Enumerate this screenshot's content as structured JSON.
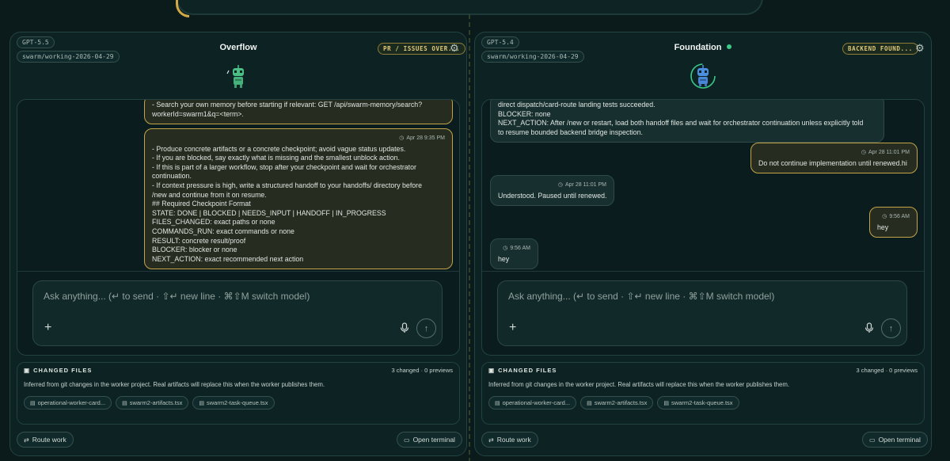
{
  "left_panel": {
    "model": "GPT-5.5",
    "branch": "swarm/working-2026-04-29",
    "title": "Overflow",
    "tag": "PR / ISSUES OVER...",
    "messages": [
      {
        "role": "user",
        "lines": [
          "- Search your own memory before starting if relevant: GET /api/swarm-memory/search?",
          "workerId=swarm1&q=<term>."
        ]
      },
      {
        "role": "user",
        "time": "Apr 28 9:35 PM",
        "lines": [
          "- Produce concrete artifacts or a concrete checkpoint; avoid vague status updates.",
          "- If you are blocked, say exactly what is missing and the smallest unblock action.",
          "- If this is part of a larger workflow, stop after your checkpoint and wait for orchestrator",
          "continuation.",
          "- If context pressure is high, write a structured handoff to your handoffs/ directory before",
          "/new and continue from it on resume.",
          "## Required Checkpoint Format",
          "STATE: DONE | BLOCKED | NEEDS_INPUT | HANDOFF | IN_PROGRESS",
          "FILES_CHANGED: exact paths or none",
          "COMMANDS_RUN: exact commands or none",
          "RESULT: concrete result/proof",
          "BLOCKER: blocker or none",
          "NEXT_ACTION: exact recommended next action"
        ]
      }
    ],
    "composer_placeholder": "Ask anything... (↵ to send · ⇧↵ new line · ⌘⇧M switch model)",
    "changed_files": {
      "heading": "CHANGED FILES",
      "count": "3 changed · 0 previews",
      "description": "Inferred from git changes in the worker project. Real artifacts will replace this when the worker publishes them.",
      "files": [
        "operational-worker-card...",
        "swarm2-artifacts.tsx",
        "swarm2-task-queue.tsx"
      ]
    },
    "route_label": "Route work",
    "terminal_label": "Open terminal"
  },
  "right_panel": {
    "model": "GPT-5.4",
    "branch": "swarm/working-2026-04-29",
    "title": "Foundation",
    "tag": "BACKEND FOUND...",
    "messages": [
      {
        "role": "agent",
        "lines": [
          "direct dispatch/card-route landing tests succeeded.",
          "BLOCKER: none",
          "NEXT_ACTION: After /new or restart, load both handoff files and wait for orchestrator continuation unless explicitly told",
          "to resume bounded backend bridge inspection."
        ]
      },
      {
        "role": "user",
        "time": "Apr 28 11:01 PM",
        "lines": [
          "Do not continue implementation until renewed.hi"
        ]
      },
      {
        "role": "agent",
        "time": "Apr 28 11:01 PM",
        "lines": [
          "Understood. Paused until renewed."
        ]
      },
      {
        "role": "user",
        "time": "9:56 AM",
        "lines": [
          "hey"
        ]
      },
      {
        "role": "agent",
        "time": "9:56 AM",
        "lines": [
          "hey"
        ]
      }
    ],
    "composer_placeholder": "Ask anything... (↵ to send · ⇧↵ new line · ⌘⇧M switch model)",
    "changed_files": {
      "heading": "CHANGED FILES",
      "count": "3 changed · 0 previews",
      "description": "Inferred from git changes in the worker project. Real artifacts will replace this when the worker publishes them.",
      "files": [
        "operational-worker-card...",
        "swarm2-artifacts.tsx",
        "swarm2-task-queue.tsx"
      ]
    },
    "route_label": "Route work",
    "terminal_label": "Open terminal"
  },
  "colors": {
    "background": "#0b1b1c",
    "user_bubble_border": "#c4a446",
    "status_online": "#3cc98a"
  },
  "icons": {
    "settings": "gear-icon",
    "send": "arrow-up-icon",
    "mic": "microphone-icon",
    "attach": "plus-icon",
    "clock": "clock-icon",
    "file": "file-icon",
    "route": "route-icon",
    "terminal": "terminal-icon"
  }
}
